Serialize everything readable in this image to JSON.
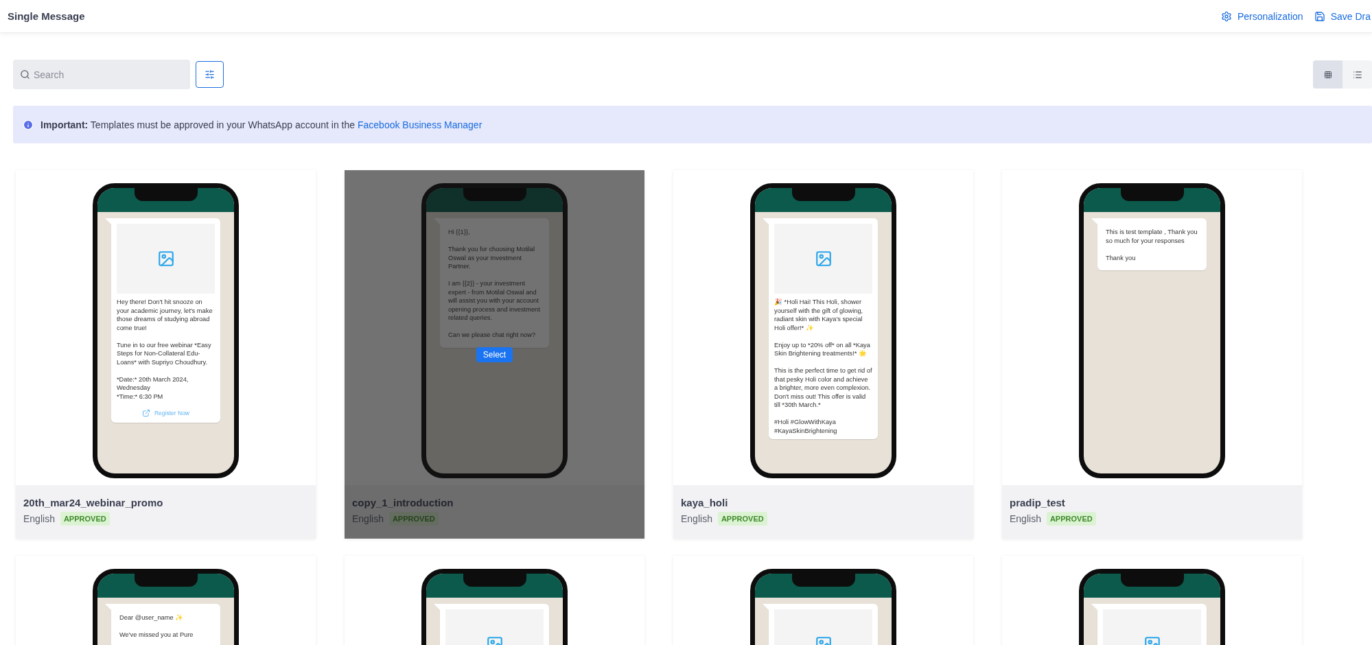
{
  "header": {
    "title": "Single Message",
    "actions": [
      {
        "kind": "settings",
        "label": "Personalization"
      },
      {
        "kind": "save",
        "label": "Save Dra"
      }
    ]
  },
  "toolbar": {
    "search": {
      "placeholder": "Search"
    },
    "views": [
      {
        "kind": "grid",
        "selected": true
      },
      {
        "kind": "list",
        "selected": false
      }
    ]
  },
  "banner": {
    "label": "Important:",
    "text": "Templates must be approved in your WhatsApp account in the",
    "link": "Facebook Business Manager"
  },
  "hover_action": "Select",
  "templates": [
    {
      "name": "20th_mar24_webinar_promo",
      "language": "English",
      "status": "APPROVED",
      "hovered": false,
      "message": {
        "image": true,
        "text": "Hey there! Don't hit snooze on your academic journey, let's make those dreams of studying abroad come true!\n\nTune in to our free webinar *Easy Steps for Non-Collateral Edu-Loans* with Supriyo Choudhury.\n\n*Date:* 20th March 2024, Wednesday\n*Time:* 6:30 PM",
        "button": "Register Now"
      }
    },
    {
      "name": "copy_1_introduction",
      "language": "English",
      "status": "APPROVED",
      "hovered": true,
      "message": {
        "image": false,
        "text": "Hi {{1}},\n\nThank you for choosing Motilal Oswal as your Investment Partner.\n\nI am {{2}} - your investment expert - from Motilal Oswal and will assist you with your account opening process and investment related queries.\n\nCan we please chat right now?"
      }
    },
    {
      "name": "kaya_holi",
      "language": "English",
      "status": "APPROVED",
      "hovered": false,
      "message": {
        "image": true,
        "text": "🎉 *Holi Hai! This Holi, shower yourself with the gift of glowing, radiant skin with Kaya's special Holi offer!* ✨\n\nEnjoy up to *20% off* on all *Kaya Skin Brightening treatments!* 🌟\n\nThis is the perfect time to get rid of that pesky Holi color and achieve a brighter, more even complexion. Don't miss out! This offer is valid till *30th March.*\n\n#Holi #GlowWithKaya\n#KayaSkinBrightening"
      }
    },
    {
      "name": "pradip_test",
      "language": "English",
      "status": "APPROVED",
      "hovered": false,
      "message": {
        "image": false,
        "text": "This is test template , Thank you so much for your responses\n\nThank you"
      }
    },
    {
      "hovered": false,
      "message": {
        "image": false,
        "text": "Dear @user_name ✨\n\nWe've missed you at Pure"
      }
    },
    {
      "hovered": false,
      "message": {
        "image": true
      }
    },
    {
      "hovered": false,
      "message": {
        "image": true
      }
    },
    {
      "hovered": false,
      "message": {
        "image": true
      }
    }
  ]
}
